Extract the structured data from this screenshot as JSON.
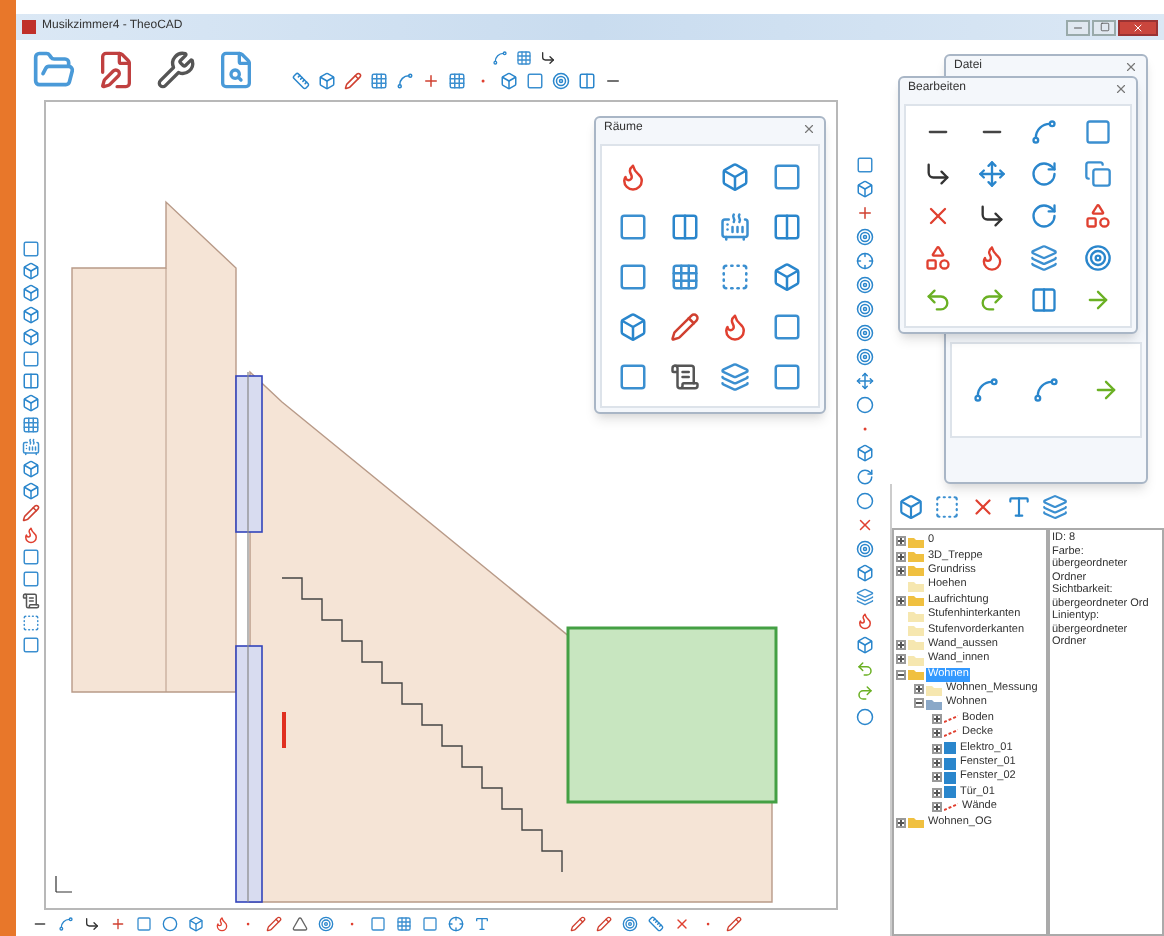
{
  "window": {
    "title": "Musikzimmer4 - TheoCAD"
  },
  "rooms_palette": {
    "title": "Räume"
  },
  "file_palette": {
    "title": "Datei"
  },
  "edit_palette": {
    "title": "Bearbeiten"
  },
  "layer_tree": {
    "items": [
      {
        "label": "0",
        "kind": "folder",
        "expanded": false,
        "selected": false
      },
      {
        "label": "3D_Treppe",
        "kind": "folder",
        "expanded": false,
        "selected": false
      },
      {
        "label": "Grundriss",
        "kind": "folder",
        "expanded": false,
        "selected": false
      },
      {
        "label": "Hoehen",
        "kind": "empty",
        "selected": false
      },
      {
        "label": "Laufrichtung",
        "kind": "folder",
        "expanded": false,
        "selected": false
      },
      {
        "label": "Stufenhinterkanten",
        "kind": "empty",
        "selected": false
      },
      {
        "label": "Stufenvorderkanten",
        "kind": "empty",
        "selected": false
      },
      {
        "label": "Wand_aussen",
        "kind": "empty",
        "expanded": false,
        "selected": false
      },
      {
        "label": "Wand_innen",
        "kind": "empty",
        "expanded": false,
        "selected": false
      },
      {
        "label": "Wohnen",
        "kind": "folder",
        "expanded": true,
        "selected": true,
        "children": [
          {
            "label": "Wohnen_Messung",
            "kind": "empty",
            "expanded": false,
            "selected": false
          },
          {
            "label": "Wohnen",
            "kind": "group",
            "expanded": true,
            "selected": false,
            "children": [
              {
                "label": "Boden",
                "kind": "layer",
                "expanded": false,
                "selected": false
              },
              {
                "label": "Decke",
                "kind": "layer",
                "expanded": false,
                "selected": false
              },
              {
                "label": "Elektro_01",
                "kind": "element",
                "expanded": false,
                "selected": false
              },
              {
                "label": "Fenster_01",
                "kind": "element",
                "expanded": false,
                "selected": false
              },
              {
                "label": "Fenster_02",
                "kind": "element",
                "expanded": false,
                "selected": false
              },
              {
                "label": "Tür_01",
                "kind": "element",
                "expanded": false,
                "selected": false
              },
              {
                "label": "Wände",
                "kind": "layer",
                "expanded": false,
                "selected": false
              }
            ]
          }
        ]
      },
      {
        "label": "Wohnen_OG",
        "kind": "folder",
        "expanded": false,
        "selected": false
      }
    ]
  },
  "properties": {
    "lines": [
      "ID: 8",
      "Farbe: übergeordneter Ordner",
      "Sichtbarkeit: übergeordneter Ord",
      "Linientyp: übergeordneter Ordner"
    ]
  }
}
